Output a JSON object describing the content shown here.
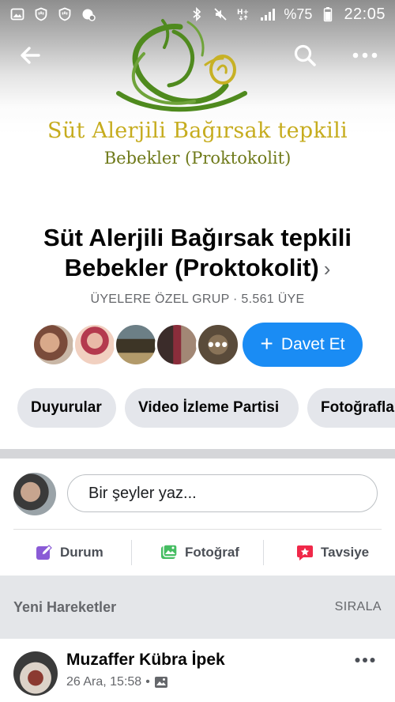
{
  "status_bar": {
    "left_icons": [
      "gallery-notification-icon",
      "shield-hand-icon",
      "shield-hand-icon-2",
      "location-settings-icon"
    ],
    "right_icons": [
      "bluetooth-icon",
      "mute-icon",
      "hplus-data-icon",
      "signal-icon"
    ],
    "battery": "%75",
    "time": "22:05"
  },
  "nav": {
    "back_icon": "arrow-left-icon",
    "search_icon": "search-icon",
    "more_icon": "more-horizontal-icon"
  },
  "cover": {
    "title": "Süt Alerjili Bağırsak tepkili",
    "subtitle": "Bebekler (Proktokolit)",
    "logo_colors": {
      "green": "#4f8a1e",
      "yellow": "#c7b125"
    }
  },
  "group": {
    "name_line1": "Süt Alerjili Bağırsak tepkili",
    "name_line2": "Bebekler (Proktokolit)",
    "chevron": "›",
    "meta": "ÜYELERE ÖZEL GRUP · 5.561 ÜYE"
  },
  "members": {
    "more_dots": "•••",
    "invite_label": "Davet Et",
    "invite_plus": "+",
    "invite_color": "#1a8cf4"
  },
  "tabs": [
    {
      "label": "Duyurular"
    },
    {
      "label": "Video İzleme Partisi"
    },
    {
      "label": "Fotoğrafla"
    }
  ],
  "composer": {
    "placeholder": "Bir şeyler yaz..."
  },
  "actions": [
    {
      "label": "Durum",
      "icon": "edit-square-icon",
      "color": "#8a5bd6"
    },
    {
      "label": "Fotoğraf",
      "icon": "photo-icon",
      "color": "#45bd62"
    },
    {
      "label": "Tavsiye",
      "icon": "recommend-star-icon",
      "color": "#f02849"
    }
  ],
  "recent": {
    "title": "Yeni Hareketler",
    "sort_label": "SIRALA"
  },
  "post": {
    "author": "Muzaffer Kübra İpek",
    "time": "26 Ara, 15:58",
    "separator": "•",
    "privacy_icon": "photo-album-icon",
    "more_dots": "•••"
  }
}
